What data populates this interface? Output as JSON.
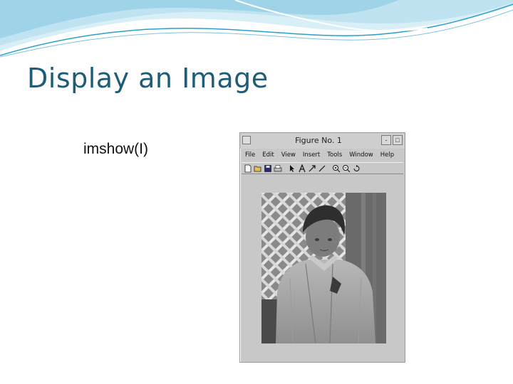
{
  "slide": {
    "title": "Display an Image",
    "code": "imshow(I)"
  },
  "figure_window": {
    "title": "Figure No. 1",
    "minimize_glyph": "-",
    "maximize_glyph": "□",
    "menu": [
      "File",
      "Edit",
      "View",
      "Insert",
      "Tools",
      "Window",
      "Help"
    ],
    "toolbar_icons": [
      "new-icon",
      "open-icon",
      "save-icon",
      "print-icon",
      "arrow-icon",
      "text-icon",
      "arrow-line-icon",
      "line-icon",
      "zoom-in-icon",
      "zoom-out-icon",
      "rotate-icon"
    ]
  },
  "colors": {
    "title": "#1f5c78",
    "window_bg": "#c8c8c8",
    "wave_light": "#bfe3f0",
    "wave_dark": "#2aa0c8"
  }
}
